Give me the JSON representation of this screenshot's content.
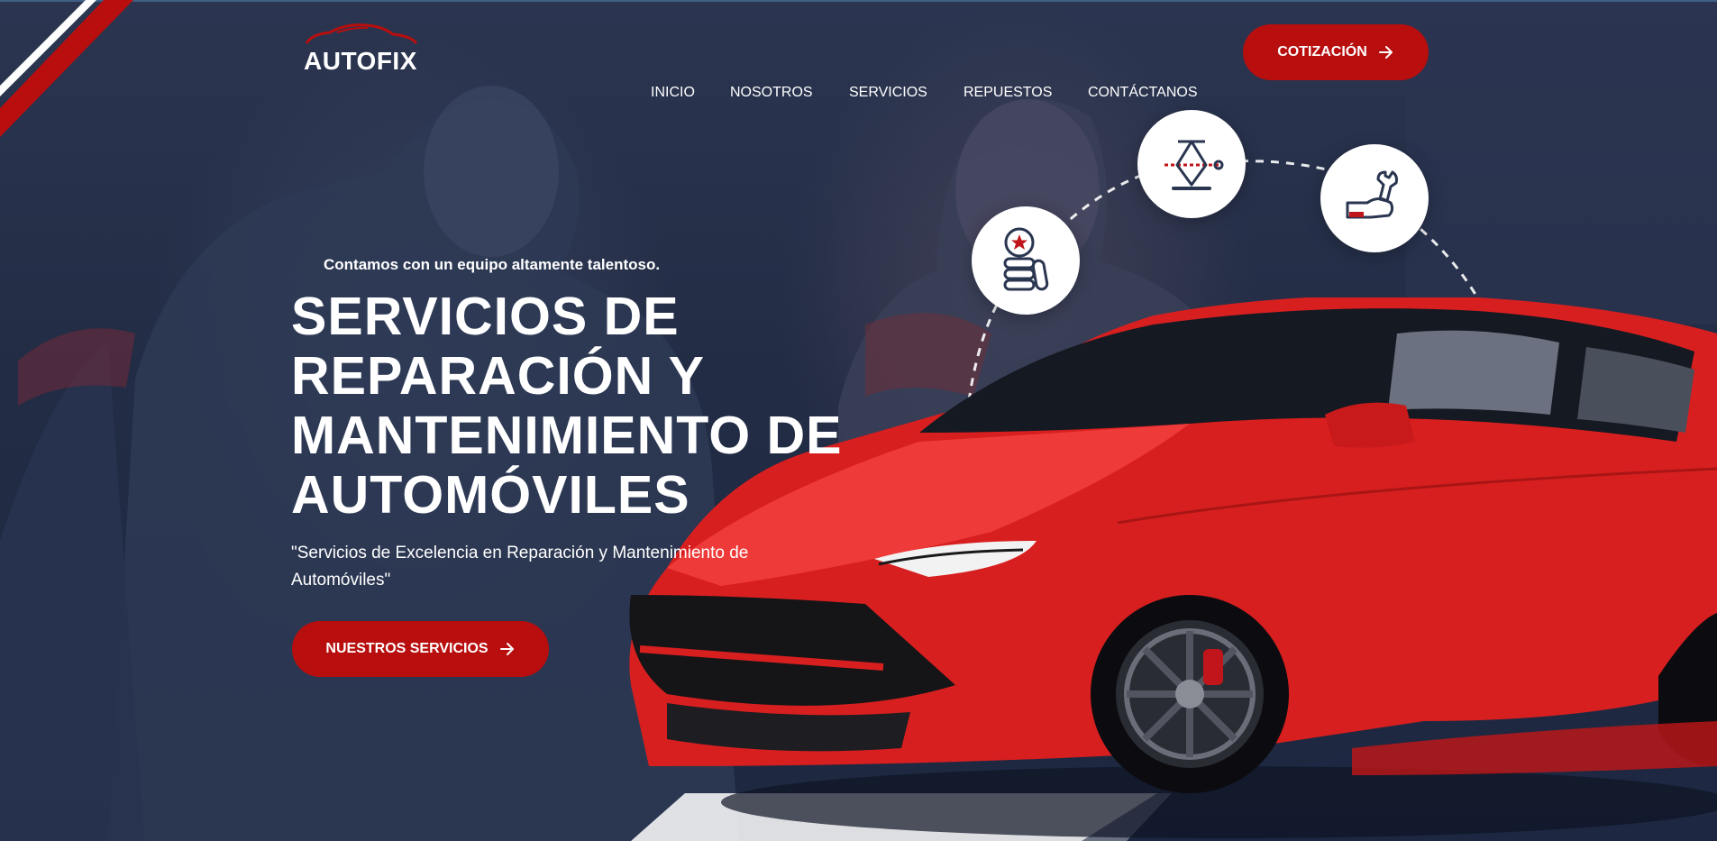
{
  "brand": {
    "name": "AUTOFIX",
    "accent_color": "#b80e0e",
    "logo_icon": "car-silhouette-icon"
  },
  "nav": {
    "items": [
      {
        "label": "INICIO"
      },
      {
        "label": "NOSOTROS"
      },
      {
        "label": "SERVICIOS"
      },
      {
        "label": "REPUESTOS"
      },
      {
        "label": "CONTÁCTANOS"
      }
    ],
    "cta_label": "COTIZACIÓN",
    "cta_icon": "arrow-right-icon"
  },
  "services_icons": [
    {
      "name": "tire-service-icon"
    },
    {
      "name": "car-jack-icon"
    },
    {
      "name": "wrench-hand-icon"
    }
  ],
  "hero": {
    "eyebrow": "Contamos con un equipo altamente talentoso.",
    "headline_lines": [
      "SERVICIOS DE",
      "REPARACIÓN Y",
      "MANTENIMIENTO DE",
      "AUTOMÓVILES"
    ],
    "subtitle": "\"Servicios de Excelencia en Reparación y Mantenimiento de Automóviles\"",
    "button_label": "NUESTROS SERVICIOS",
    "button_icon": "arrow-right-icon",
    "image": "red-suv-car"
  },
  "colors": {
    "overlay": "#222c44",
    "car_red": "#e02828",
    "text": "#ffffff"
  }
}
